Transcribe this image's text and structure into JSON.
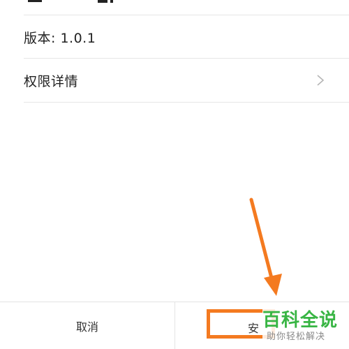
{
  "details": {
    "version_label": "版本: 1.0.1",
    "permissions_label": "权限详情"
  },
  "bottom_bar": {
    "cancel_label": "取消",
    "install_label_partial": "安"
  },
  "annotation": {
    "color": "#f47a20"
  },
  "watermark": {
    "title": "百科全说",
    "subtitle": "助你轻松解决",
    "title_color": "#38b544",
    "subtitle_color": "#8a8a8a"
  },
  "icons": {
    "row_chevron": "chevron-right-icon"
  }
}
